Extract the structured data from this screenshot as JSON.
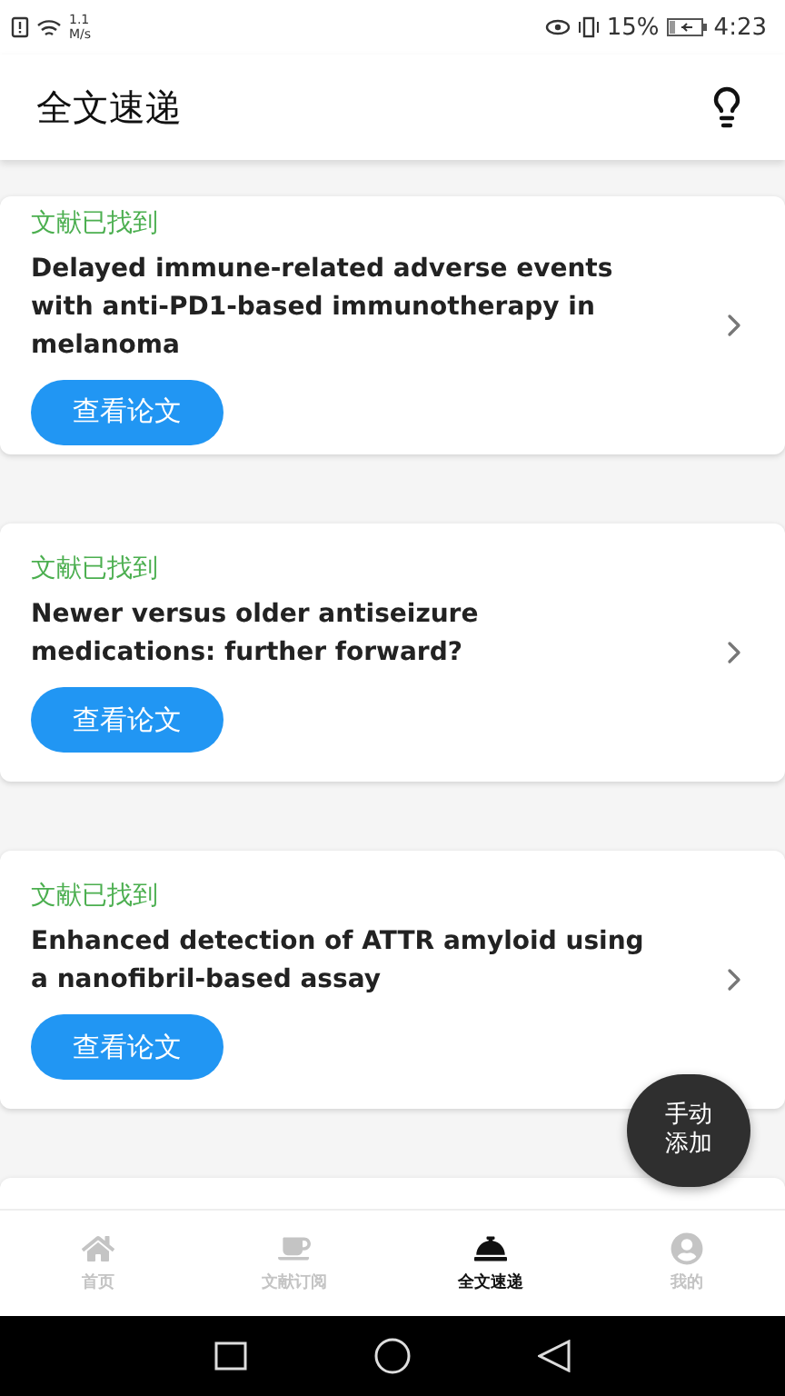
{
  "status_bar": {
    "speed_value": "1.1",
    "speed_unit": "M/s",
    "battery": "15%",
    "time": "4:23"
  },
  "header": {
    "title": "全文速递"
  },
  "cards": [
    {
      "status": "文献已找到",
      "title": "Delayed immune-related adverse events with anti-PD1-based immunotherapy in melanoma",
      "button": "查看论文"
    },
    {
      "status": "文献已找到",
      "title": "Newer versus older antiseizure medications: further forward?",
      "button": "查看论文"
    },
    {
      "status": "文献已找到",
      "title": "Enhanced detection of ATTR amyloid using a nanofibril-based assay",
      "button": "查看论文"
    }
  ],
  "fab": {
    "label": "手动添加"
  },
  "bottom_nav": [
    {
      "label": "首页",
      "kind": "home",
      "selected": false
    },
    {
      "label": "文献订阅",
      "kind": "cup",
      "selected": false
    },
    {
      "label": "全文速递",
      "kind": "cloche",
      "selected": true
    },
    {
      "label": "我的",
      "kind": "user",
      "selected": false
    }
  ]
}
